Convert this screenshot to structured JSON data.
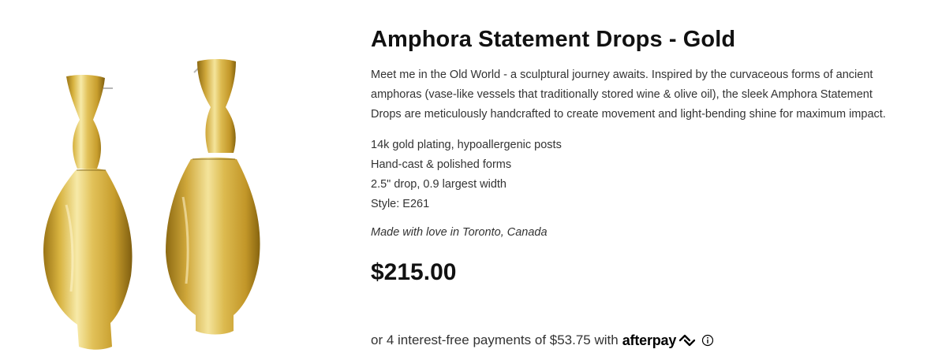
{
  "product": {
    "title": "Amphora Statement Drops - Gold",
    "description": "Meet me in the Old World - a sculptural journey awaits. Inspired by the curvaceous forms of ancient amphoras (vase-like vessels that traditionally stored wine & olive oil), the sleek Amphora Statement Drops are meticulously handcrafted to create movement and light-bending shine for maximum impact.",
    "features": [
      "14k gold plating, hypoallergenic posts",
      "Hand-cast & polished forms",
      "2.5\" drop, 0.9 largest width",
      "Style: E261"
    ],
    "origin": "Made with love in Toronto, Canada",
    "price": "$215.00",
    "image_icon": "gold-earrings-image"
  },
  "afterpay": {
    "text": "or 4 interest-free payments of $53.75 with",
    "brand": "afterpay",
    "logo_icon": "afterpay-arrows-icon",
    "info_icon": "info-icon"
  },
  "colors": {
    "gold_light": "#f6e9a6",
    "gold_mid": "#d9b545",
    "gold_dark": "#8d6a12",
    "text": "#333333",
    "heading": "#111111"
  }
}
